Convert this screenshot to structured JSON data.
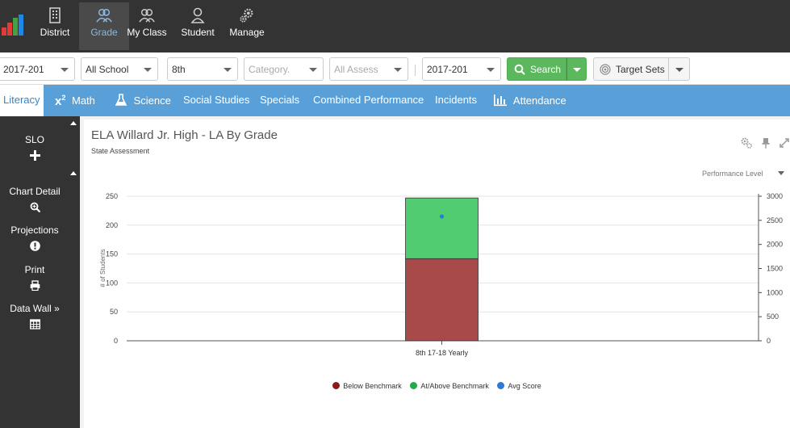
{
  "topnav": {
    "items": [
      {
        "label": "District",
        "icon": "building-icon"
      },
      {
        "label": "Grade",
        "icon": "users-icon",
        "active": true
      },
      {
        "label": "My Class",
        "icon": "users-icon"
      },
      {
        "label": "Student",
        "icon": "user-icon"
      },
      {
        "label": "Manage",
        "icon": "gears-icon"
      }
    ]
  },
  "filters": {
    "year": "2017-201",
    "school": "All School",
    "grade": "8th",
    "category_placeholder": "Category.",
    "assessment_placeholder": "All Assess",
    "year2": "2017-201",
    "search_label": "Search",
    "target_sets_label": "Target Sets"
  },
  "tabs": [
    {
      "label": "Literacy",
      "active": true
    },
    {
      "label": "Math",
      "icon": "x-squared-icon"
    },
    {
      "label": "Science",
      "icon": "flask-icon"
    },
    {
      "label": "Social Studies"
    },
    {
      "label": "Specials"
    },
    {
      "label": "Combined Performance"
    },
    {
      "label": "Incidents"
    },
    {
      "label": "Attendance",
      "icon": "bar-chart-icon"
    }
  ],
  "sidebar": {
    "items": [
      {
        "label": "SLO",
        "icon": "plus-icon"
      },
      {
        "label": "Chart Detail",
        "icon": "zoom-icon"
      },
      {
        "label": "Projections",
        "icon": "exclamation-icon"
      },
      {
        "label": "Print",
        "icon": "print-icon"
      },
      {
        "label": "Data Wall »",
        "icon": "table-icon"
      }
    ]
  },
  "panel": {
    "title": "ELA Willard Jr. High - LA By Grade",
    "subtitle": "State Assessment",
    "performance_level": "Performance Level"
  },
  "colors": {
    "below": "#a84a4a",
    "above": "#52cc70",
    "avg": "#2a7ad6",
    "tabbar": "#5aa0d8",
    "search": "#5cb85c"
  },
  "chart_data": {
    "type": "bar",
    "stacked": true,
    "categories": [
      "8th 17-18 Yearly"
    ],
    "series": [
      {
        "name": "Below Benchmark",
        "values": [
          142
        ]
      },
      {
        "name": "At/Above Benchmark",
        "values": [
          105
        ]
      }
    ],
    "avg_score": {
      "name": "Avg Score",
      "values": [
        2580
      ]
    },
    "ylabel": "# of Students",
    "ylim": [
      0,
      250
    ],
    "yticks": [
      0,
      50,
      100,
      150,
      200,
      250
    ],
    "y2lim": [
      0,
      3000
    ],
    "y2ticks": [
      0,
      500,
      1000,
      1500,
      2000,
      2500,
      3000
    ],
    "grid": true,
    "legend_position": "bottom"
  }
}
